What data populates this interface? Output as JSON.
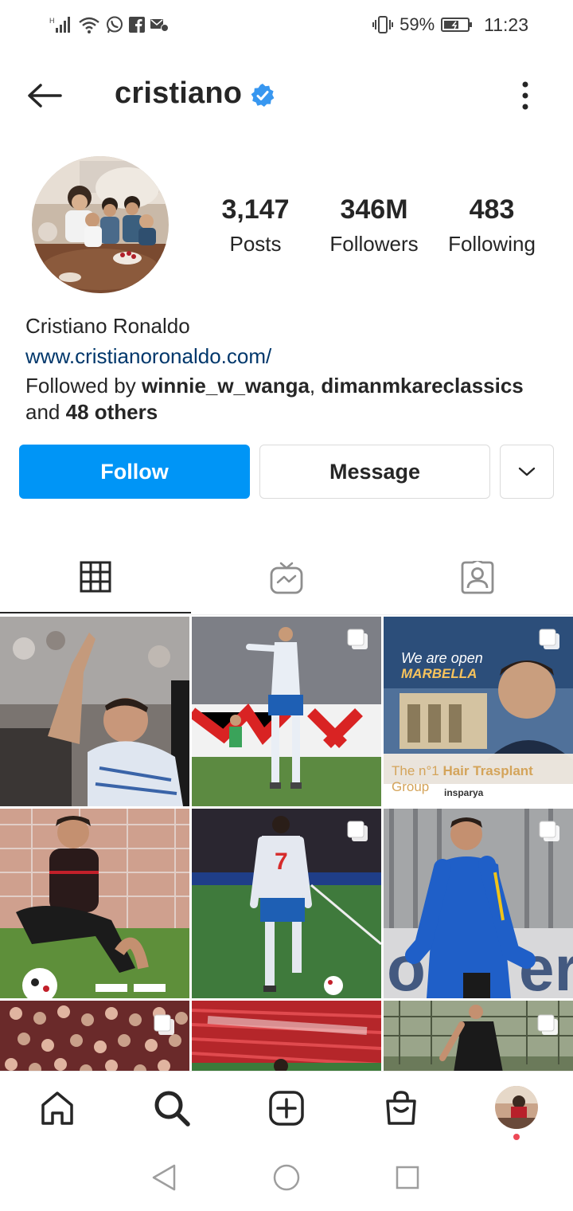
{
  "status_bar": {
    "battery_percent": "59%",
    "time": "11:23",
    "icons": [
      "network-signal-icon",
      "wifi-icon",
      "whatsapp-icon",
      "facebook-icon",
      "sms-icon",
      "vibrate-icon",
      "battery-icon"
    ]
  },
  "header": {
    "username": "cristiano",
    "verified": true,
    "icons": [
      "back-arrow-icon",
      "verified-badge-icon",
      "more-options-icon"
    ]
  },
  "profile": {
    "stats": [
      {
        "value": "3,147",
        "label": "Posts"
      },
      {
        "value": "346M",
        "label": "Followers"
      },
      {
        "value": "483",
        "label": "Following"
      }
    ],
    "full_name": "Cristiano Ronaldo",
    "website": "www.cristianoronaldo.com/",
    "followed_by": {
      "prefix": "Followed by ",
      "user1": "winnie_w_wanga",
      "separator": ", ",
      "user2": "dimanmkareclassics",
      "middle": "and ",
      "others": "48 others"
    }
  },
  "actions": {
    "follow_label": "Follow",
    "message_label": "Message",
    "accent_color": "#0095f6"
  },
  "tabs": [
    {
      "name": "posts-grid",
      "icon": "grid-icon",
      "active": true
    },
    {
      "name": "igtv",
      "icon": "igtv-icon",
      "active": false
    },
    {
      "name": "tagged",
      "icon": "tagged-user-icon",
      "active": false
    }
  ],
  "grid_posts": [
    {
      "type": "photo",
      "multi": false
    },
    {
      "type": "photo",
      "multi": true
    },
    {
      "type": "promo",
      "multi": true,
      "text1": "We are open",
      "text2": "MARBELLA",
      "text3_pre": "The n°1 ",
      "text3_bold": "Hair Trasplant",
      "text3_post": " Group",
      "brand": "insparya"
    },
    {
      "type": "photo",
      "multi": false
    },
    {
      "type": "photo",
      "multi": true
    },
    {
      "type": "photo",
      "multi": true
    },
    {
      "type": "photo",
      "multi": true
    },
    {
      "type": "photo",
      "multi": false
    },
    {
      "type": "photo",
      "multi": true
    }
  ],
  "bottom_nav": [
    "home-icon",
    "search-icon",
    "new-post-icon",
    "shop-icon",
    "profile-avatar"
  ],
  "system_nav": [
    "back-triangle-icon",
    "home-circle-icon",
    "recents-square-icon"
  ]
}
